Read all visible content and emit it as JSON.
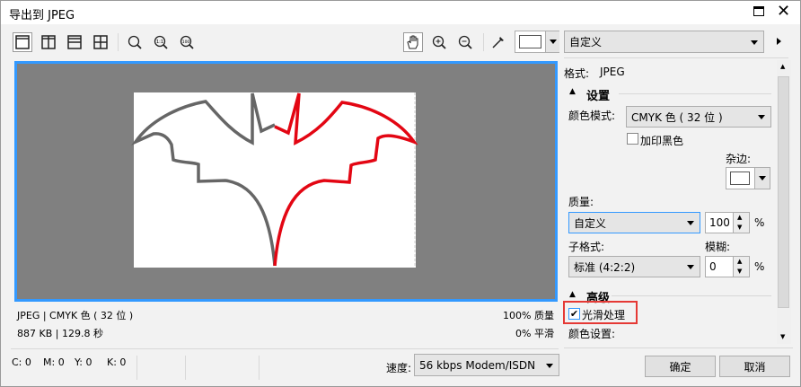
{
  "window": {
    "title": "导出到 JPEG"
  },
  "toolbar": {
    "preset": "自定义"
  },
  "preview": {
    "stroke_left": "#666666",
    "stroke_right": "#e30613",
    "border_color": "#3399ff"
  },
  "info": {
    "format_color": "JPEG | CMYK 色 ( 32 位 )",
    "size_time": "887 KB | 129.8 秒",
    "quality": "100% 质量",
    "smoothing": "0% 平滑"
  },
  "status": {
    "c": "C: 0",
    "m": "M: 0",
    "y": "Y: 0",
    "k": "K: 0",
    "speed_label": "速度:",
    "speed_value": "56 kbps Modem/ISDN"
  },
  "panel": {
    "format_label": "格式:",
    "format_value": "JPEG",
    "settings_header": "设置",
    "color_mode_label": "颜色模式:",
    "color_mode_value": "CMYK 色 ( 32 位 )",
    "overprint_black": "加印黑色",
    "matte_label": "杂边:",
    "quality_label": "质量:",
    "quality_value": "自定义",
    "quality_number": "100",
    "percent": "%",
    "subformat_label": "子格式:",
    "subformat_value": "标准 (4:2:2)",
    "blur_label": "模糊:",
    "blur_value": "0",
    "advanced_header": "高级",
    "smoothing_label": "光滑处理",
    "smoothing_checked": true,
    "color_settings_label": "颜色设置:"
  },
  "buttons": {
    "ok": "确定",
    "cancel": "取消"
  }
}
